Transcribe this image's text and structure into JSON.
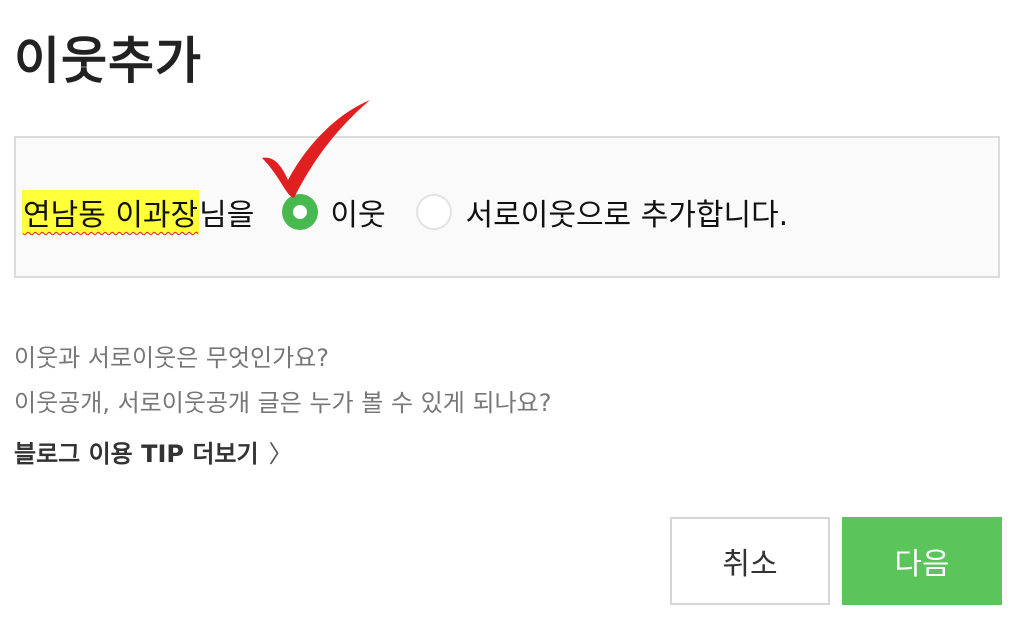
{
  "dialog": {
    "title": "이웃추가"
  },
  "option": {
    "name_highlight": "연남동 이과장",
    "name_suffix": "님을",
    "radio_neighbor_label": "이웃",
    "radio_mutual_label": "서로이웃으로 추가합니다.",
    "selected": "이웃"
  },
  "help": {
    "question1": "이웃과 서로이웃은 무엇인가요?",
    "question2": "이웃공개, 서로이웃공개 글은 누가 볼 수 있게 되나요?",
    "tip_label": "블로그 이용 TIP 더보기",
    "tip_chevron": "〉"
  },
  "buttons": {
    "cancel": "취소",
    "next": "다음"
  },
  "colors": {
    "accent_green": "#5bc55b",
    "radio_green": "#47b94f",
    "highlight_yellow": "#ffff3a",
    "annotation_red": "#e02020"
  }
}
